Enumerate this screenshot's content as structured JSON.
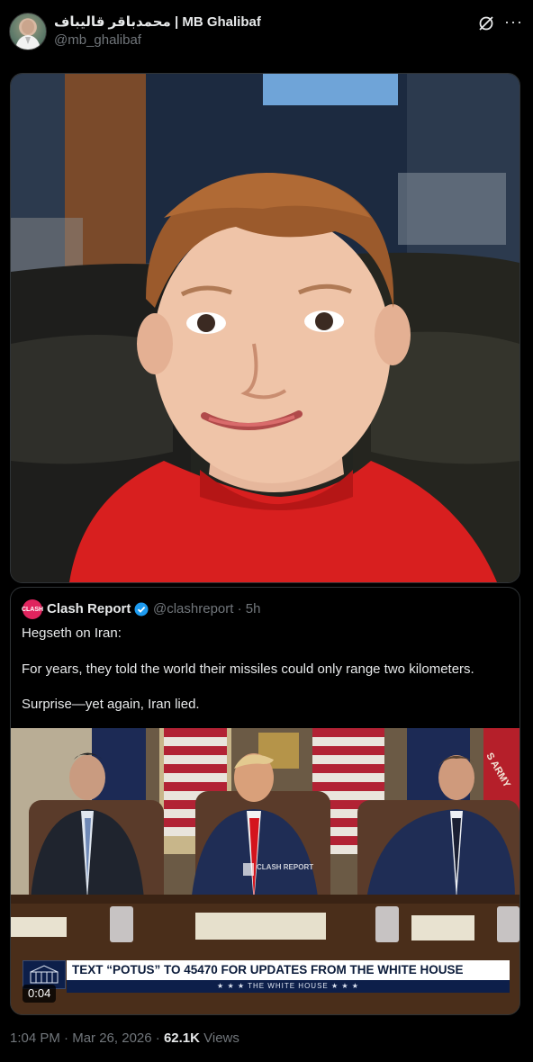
{
  "post": {
    "display_name": "محمدباقر قالیباف | MB Ghalibaf",
    "handle": "@mb_ghalibaf",
    "icons": {
      "grok": "grok-icon",
      "more": "more-icon"
    },
    "image_alt": "Smiling child in a red t-shirt sitting on a leather couch",
    "meta": {
      "time": "1:04 PM",
      "separator1": " · ",
      "date": "Mar 26, 2026",
      "separator2": " · ",
      "views_count": "62.1K",
      "views_label": " Views"
    }
  },
  "quote": {
    "logo_text": "CLASH",
    "name": "Clash Report",
    "handle_time": "@clashreport · 5h",
    "lines": [
      "Hegseth on Iran:",
      "For years, they told the world their missiles could only range two kilometers.",
      "Surprise—yet again, Iran lied."
    ],
    "video": {
      "banner_main": "TEXT “POTUS” TO 45470 FOR UPDATES FROM THE WHITE HOUSE",
      "banner_sub": "★ ★ ★   THE WHITE HOUSE   ★ ★ ★",
      "duration": "0:04",
      "watermark": "CLASH REPORT",
      "army_flag_text": "S ARMY"
    }
  },
  "colors": {
    "background": "#000000",
    "text": "#e7e9ea",
    "muted": "#71767b",
    "border": "#2f3336",
    "verified": "#1d9bf0",
    "banner_navy": "#0d1f4a"
  }
}
